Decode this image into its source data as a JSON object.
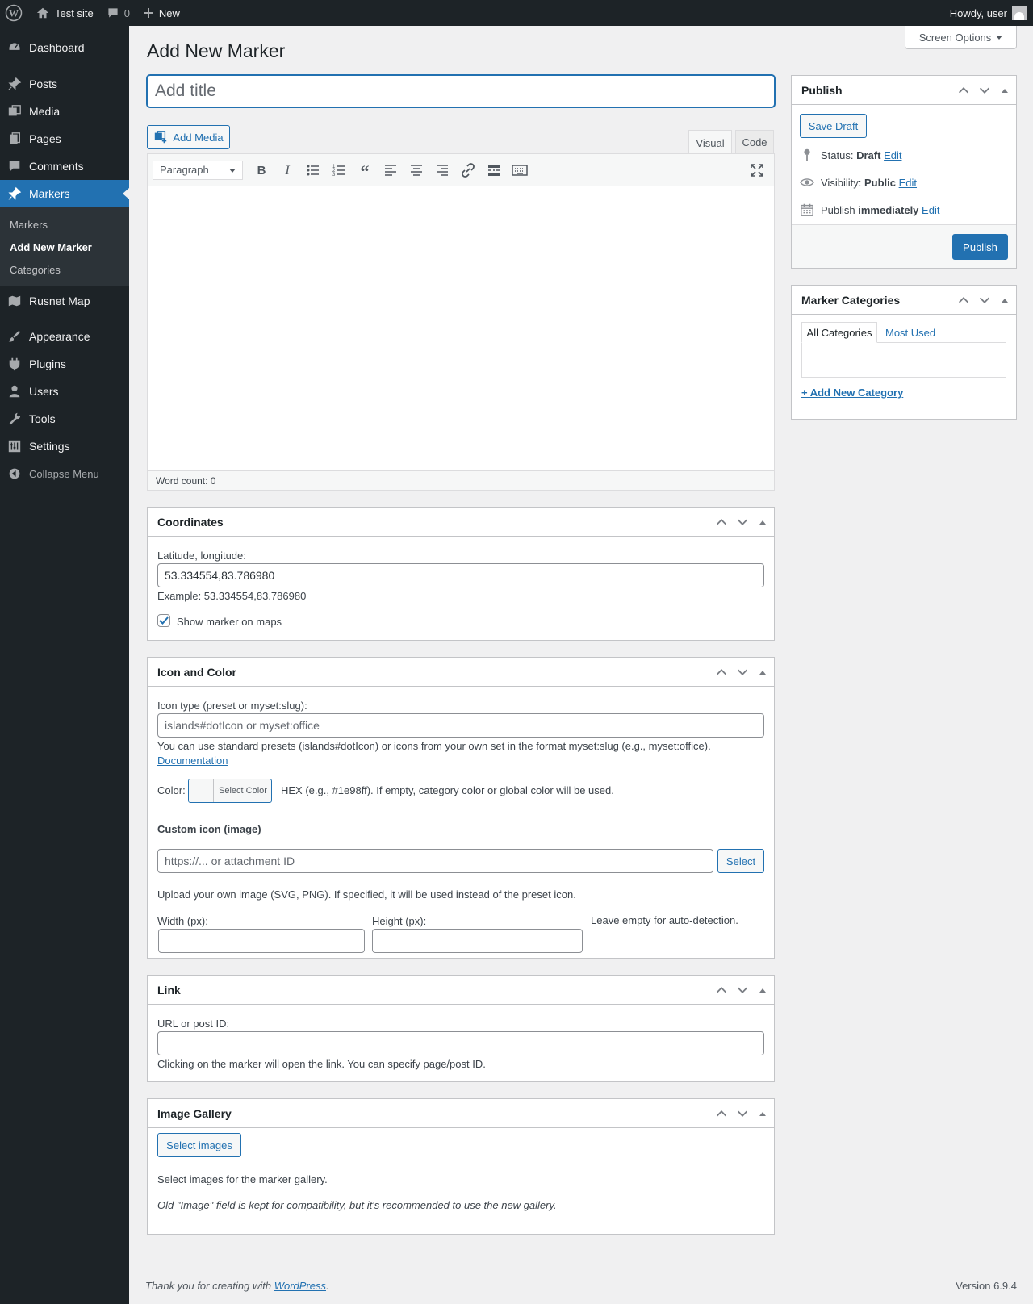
{
  "adminbar": {
    "site_name": "Test site",
    "comments_count": "0",
    "new_label": "New",
    "howdy": "Howdy, user"
  },
  "sidebar": {
    "items": [
      {
        "label": "Dashboard",
        "icon": "dashboard-icon"
      },
      {
        "label": "Posts",
        "icon": "pin-icon"
      },
      {
        "label": "Media",
        "icon": "media-icon"
      },
      {
        "label": "Pages",
        "icon": "pages-icon"
      },
      {
        "label": "Comments",
        "icon": "comments-icon"
      },
      {
        "label": "Markers",
        "icon": "pin-icon"
      },
      {
        "label": "Rusnet Map",
        "icon": "map-icon"
      },
      {
        "label": "Appearance",
        "icon": "brush-icon"
      },
      {
        "label": "Plugins",
        "icon": "plugin-icon"
      },
      {
        "label": "Users",
        "icon": "users-icon"
      },
      {
        "label": "Tools",
        "icon": "tools-icon"
      },
      {
        "label": "Settings",
        "icon": "settings-icon"
      }
    ],
    "submenu": [
      "Markers",
      "Add New Marker",
      "Categories"
    ],
    "collapse_label": "Collapse Menu"
  },
  "screen_options": "Screen Options",
  "page_title": "Add New Marker",
  "title_placeholder": "Add title",
  "editor": {
    "add_media": "Add Media",
    "tab_visual": "Visual",
    "tab_code": "Code",
    "format": "Paragraph",
    "word_count": "Word count: 0"
  },
  "coordinates": {
    "title": "Coordinates",
    "label": "Latitude, longitude:",
    "value": "53.334554,83.786980",
    "example": "Example: 53.334554,83.786980",
    "show_on_maps": "Show marker on maps"
  },
  "icon_color": {
    "title": "Icon and Color",
    "icon_label": "Icon type (preset or myset:slug):",
    "icon_placeholder": "islands#dotIcon or myset:office",
    "icon_help": "You can use standard presets (islands#dotIcon) or icons from your own set in the format myset:slug (e.g., myset:office).",
    "doc_link": "Documentation",
    "color_label": "Color:",
    "select_color": "Select Color",
    "color_help": "HEX (e.g., #1e98ff). If empty, category color or global color will be used.",
    "custom_icon_heading": "Custom icon (image)",
    "custom_placeholder": "https://... or attachment ID",
    "select_button": "Select",
    "upload_help": "Upload your own image (SVG, PNG). If specified, it will be used instead of the preset icon.",
    "width_label": "Width (px):",
    "height_label": "Height (px):",
    "auto_help": "Leave empty for auto-detection."
  },
  "link_box": {
    "title": "Link",
    "label": "URL or post ID:",
    "help": "Clicking on the marker will open the link. You can specify page/post ID."
  },
  "gallery": {
    "title": "Image Gallery",
    "button": "Select images",
    "help": "Select images for the marker gallery.",
    "note": "Old \"Image\" field is kept for compatibility, but it's recommended to use the new gallery."
  },
  "publish": {
    "title": "Publish",
    "save_draft": "Save Draft",
    "status_label": "Status:",
    "status_value": "Draft",
    "visibility_label": "Visibility:",
    "visibility_value": "Public",
    "publish_label": "Publish",
    "publish_value": "immediately",
    "edit": "Edit",
    "publish_button": "Publish"
  },
  "categories": {
    "title": "Marker Categories",
    "tab_all": "All Categories",
    "tab_most": "Most Used",
    "add_new": "+ Add New Category"
  },
  "footer": {
    "thanks_prefix": "Thank you for creating with ",
    "wp_link": "WordPress",
    "thanks_suffix": ".",
    "version": "Version 6.9.4"
  },
  "colors": {
    "accent": "#2271b1",
    "admin_dark": "#1d2327",
    "background": "#f0f0f1"
  }
}
